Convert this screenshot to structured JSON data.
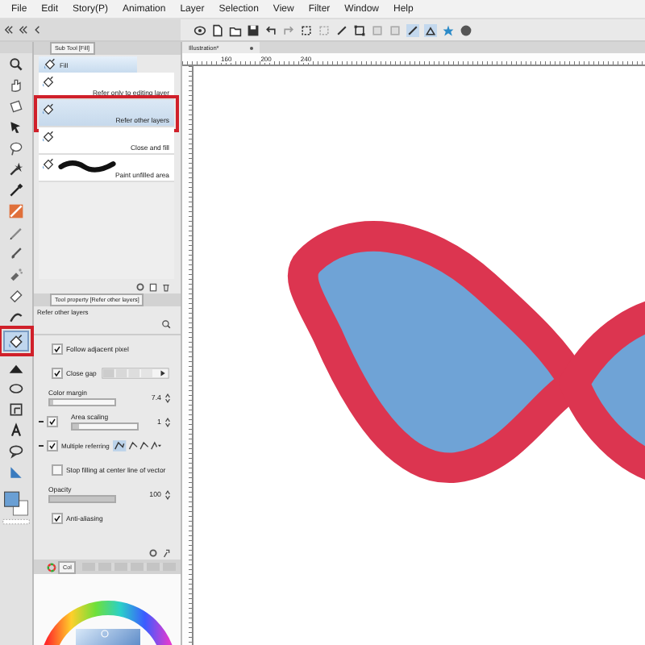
{
  "menu": [
    "File",
    "Edit",
    "Story(P)",
    "Animation",
    "Layer",
    "Selection",
    "View",
    "Filter",
    "Window",
    "Help"
  ],
  "tools": [
    {
      "kind": "zoom",
      "selected": false,
      "highlighted": false
    },
    {
      "kind": "hand",
      "selected": false,
      "highlighted": false
    },
    {
      "kind": "rotate",
      "selected": false,
      "highlighted": false
    },
    {
      "kind": "move",
      "selected": false,
      "highlighted": false
    },
    {
      "kind": "lasso",
      "selected": false,
      "highlighted": false
    },
    {
      "kind": "wand",
      "selected": false,
      "highlighted": false
    },
    {
      "kind": "eyedropper",
      "selected": false,
      "highlighted": false
    },
    {
      "kind": "pen",
      "selected": false,
      "highlighted": false
    },
    {
      "kind": "pencil",
      "selected": false,
      "highlighted": false
    },
    {
      "kind": "brush",
      "selected": false,
      "highlighted": false
    },
    {
      "kind": "airbrush",
      "selected": false,
      "highlighted": false
    },
    {
      "kind": "eraser",
      "selected": false,
      "highlighted": false
    },
    {
      "kind": "blend",
      "selected": false,
      "highlighted": false
    },
    {
      "kind": "fill",
      "selected": true,
      "highlighted": true
    },
    {
      "kind": "gradient",
      "selected": false,
      "highlighted": false
    },
    {
      "kind": "ellipse",
      "selected": false,
      "highlighted": false
    },
    {
      "kind": "frame",
      "selected": false,
      "highlighted": false
    },
    {
      "kind": "text",
      "selected": false,
      "highlighted": false
    },
    {
      "kind": "balloon",
      "selected": false,
      "highlighted": false
    },
    {
      "kind": "correct",
      "selected": false,
      "highlighted": false
    }
  ],
  "sub_tool": {
    "tab": "Sub Tool [Fill]",
    "group": "Fill",
    "items": [
      {
        "label": "Refer only to editing layer",
        "selected": false,
        "highlighted": false,
        "kind": "plain"
      },
      {
        "label": "Refer other layers",
        "selected": true,
        "highlighted": true,
        "kind": "plain"
      },
      {
        "label": "Close and fill",
        "selected": false,
        "highlighted": false,
        "kind": "plain"
      },
      {
        "label": "Paint unfilled area",
        "selected": false,
        "highlighted": false,
        "kind": "stroke"
      }
    ]
  },
  "tool_property": {
    "tab": "Tool property [Refer other layers]",
    "title": "Refer other layers",
    "rows": [
      {
        "kind": "checkbox",
        "label": "Follow adjacent pixel",
        "checked": true
      },
      {
        "kind": "checkbox-gap",
        "label": "Close gap",
        "checked": true
      },
      {
        "kind": "slider",
        "label": "Color margin",
        "level": 0.06,
        "reading": "7.4"
      },
      {
        "kind": "checkbox-slider",
        "label": "Area scaling",
        "checked": true,
        "level": 0.1,
        "reading": "1"
      },
      {
        "kind": "checkbox-refer",
        "label": "Multiple referring",
        "checked": true
      },
      {
        "kind": "checkbox",
        "label": "Stop filling at center line of vector",
        "checked": false
      },
      {
        "kind": "slider",
        "label": "Opacity",
        "level": 1,
        "reading": "100"
      },
      {
        "kind": "checkbox",
        "label": "Anti-aliasing",
        "checked": true
      }
    ]
  },
  "color_panel": {
    "tab": "Col"
  },
  "document_tab": {
    "title": "Illustration*"
  },
  "ruler_labels": [
    "160",
    "200",
    "240"
  ]
}
